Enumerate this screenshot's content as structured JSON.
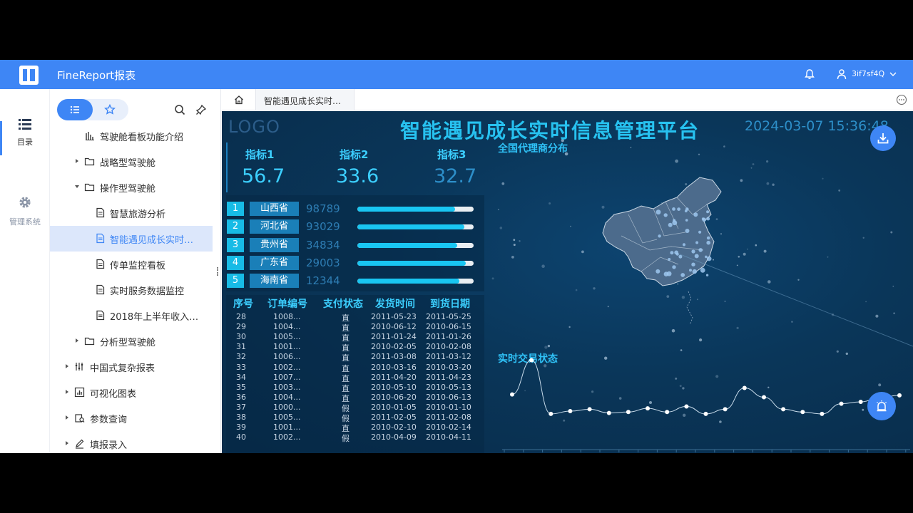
{
  "header": {
    "app_title": "FineReport报表",
    "user_name": "3if7sf4Q"
  },
  "rail": {
    "items": [
      {
        "label": "目录",
        "icon": "list-icon"
      },
      {
        "label": "管理系统",
        "icon": "gear-icon"
      }
    ]
  },
  "tree": {
    "nodes": [
      {
        "label": "驾驶舱看板功能介绍",
        "type": "chart"
      },
      {
        "label": "战略型驾驶舱",
        "type": "folder"
      },
      {
        "label": "操作型驾驶舱",
        "type": "folder"
      },
      {
        "label": "智慧旅游分析",
        "type": "doc"
      },
      {
        "label": "智能遇见成长实时…",
        "type": "doc"
      },
      {
        "label": "传单监控看板",
        "type": "doc"
      },
      {
        "label": "实时服务数据监控",
        "type": "doc"
      },
      {
        "label": "2018年上半年收入…",
        "type": "doc"
      },
      {
        "label": "分析型驾驶舱",
        "type": "folder"
      },
      {
        "label": "中国式复杂报表",
        "type": "complex"
      },
      {
        "label": "可视化图表",
        "type": "viz"
      },
      {
        "label": "参数查询",
        "type": "param"
      },
      {
        "label": "填报录入",
        "type": "edit"
      }
    ]
  },
  "tabs": {
    "active": "智能遇见成长实时…"
  },
  "dashboard": {
    "logo": "LOGO",
    "title": "智能遇见成长实时信息管理平台",
    "time": "2024-03-07 15:36:48",
    "kpis": [
      {
        "label": "指标1",
        "value": "56.7"
      },
      {
        "label": "指标2",
        "value": "33.6"
      },
      {
        "label": "指标3",
        "value": "32.7"
      }
    ],
    "ranking": [
      {
        "rank": "1",
        "province": "山西省",
        "value": "98789",
        "fill": 0.84
      },
      {
        "rank": "2",
        "province": "河北省",
        "value": "93029",
        "fill": 0.92
      },
      {
        "rank": "3",
        "province": "贵州省",
        "value": "34834",
        "fill": 0.86
      },
      {
        "rank": "4",
        "province": "广东省",
        "value": "29003",
        "fill": 0.93
      },
      {
        "rank": "5",
        "province": "海南省",
        "value": "12344",
        "fill": 0.88
      }
    ],
    "table": {
      "headers": [
        "序号",
        "订单编号",
        "支付状态",
        "发货时间",
        "到货日期"
      ],
      "rows": [
        [
          "28",
          "1008...",
          "直",
          "2011-05-23",
          "2011-05-25"
        ],
        [
          "29",
          "1004...",
          "直",
          "2010-06-12",
          "2010-06-15"
        ],
        [
          "30",
          "1005...",
          "直",
          "2011-01-24",
          "2011-01-26"
        ],
        [
          "31",
          "1001...",
          "直",
          "2010-02-05",
          "2010-02-08"
        ],
        [
          "32",
          "1006...",
          "直",
          "2011-03-08",
          "2011-03-12"
        ],
        [
          "33",
          "1002...",
          "直",
          "2010-03-16",
          "2010-03-20"
        ],
        [
          "34",
          "1007...",
          "直",
          "2011-04-20",
          "2011-04-23"
        ],
        [
          "35",
          "1003...",
          "直",
          "2010-05-10",
          "2010-05-13"
        ],
        [
          "36",
          "1004...",
          "直",
          "2010-06-20",
          "2010-06-13"
        ],
        [
          "37",
          "1000...",
          "假",
          "2010-01-05",
          "2010-01-10"
        ],
        [
          "38",
          "1005...",
          "假",
          "2011-02-05",
          "2011-02-08"
        ],
        [
          "39",
          "1001...",
          "直",
          "2010-02-10",
          "2010-02-14"
        ],
        [
          "40",
          "1002...",
          "假",
          "2010-04-09",
          "2010-04-11"
        ]
      ]
    },
    "map_title": "全国代理商分布",
    "trend_title": "实时交易状态"
  },
  "chart_data": {
    "type": "line",
    "x": [
      1,
      2,
      3,
      4,
      5,
      6,
      7,
      8,
      9,
      10,
      11,
      12,
      13,
      14,
      15,
      16,
      17,
      18,
      19,
      20,
      21
    ],
    "values": [
      48,
      85,
      27,
      30,
      32,
      28,
      29,
      33,
      29,
      35,
      27,
      32,
      55,
      45,
      32,
      29,
      27,
      38,
      40,
      45,
      47
    ],
    "ylim": [
      0,
      100
    ]
  }
}
